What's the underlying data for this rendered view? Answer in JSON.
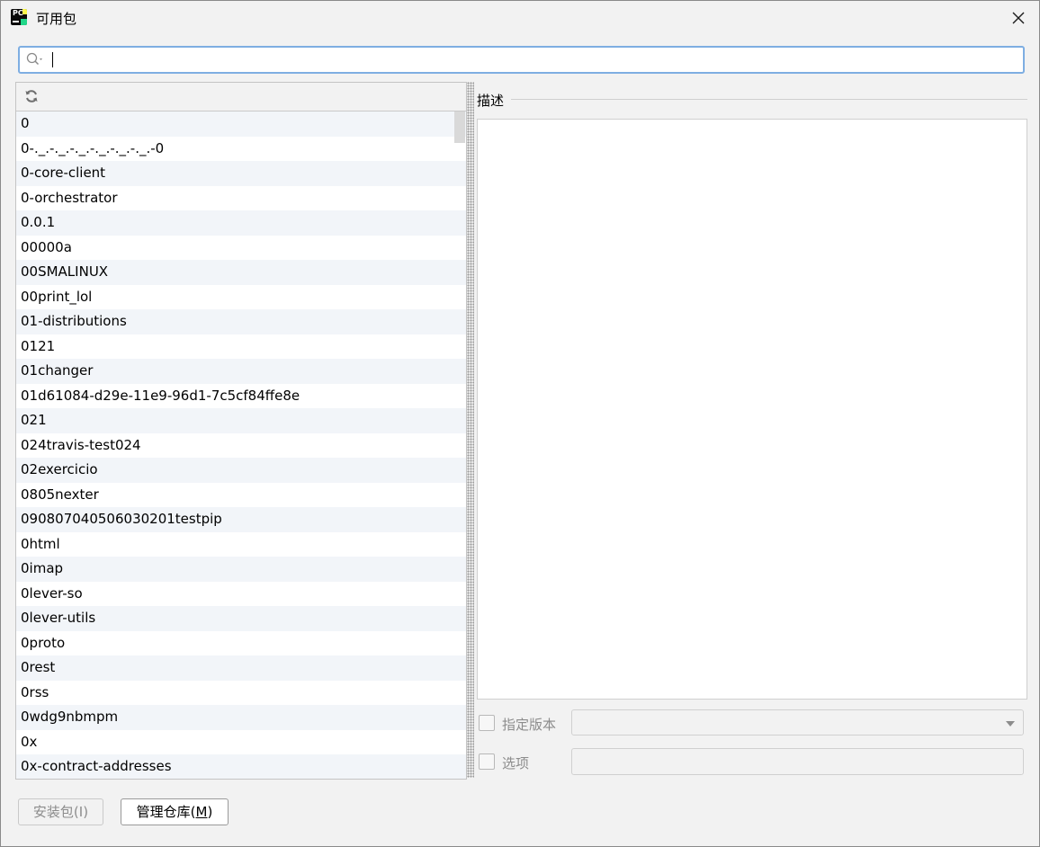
{
  "window": {
    "title": "可用包",
    "close_glyph": "✕"
  },
  "search": {
    "value": "",
    "placeholder": ""
  },
  "toolbar": {
    "refresh_icon": "refresh-icon"
  },
  "packages": [
    "0",
    "0-._.-._.-._.-._.-._.-._.-0",
    "0-core-client",
    "0-orchestrator",
    "0.0.1",
    "00000a",
    "00SMALINUX",
    "00print_lol",
    "01-distributions",
    "0121",
    "01changer",
    "01d61084-d29e-11e9-96d1-7c5cf84ffe8e",
    "021",
    "024travis-test024",
    "02exercicio",
    "0805nexter",
    "090807040506030201testpip",
    "0html",
    "0imap",
    "0lever-so",
    "0lever-utils",
    "0proto",
    "0rest",
    "0rss",
    "0wdg9nbmpm",
    "0x",
    "0x-contract-addresses"
  ],
  "description": {
    "label": "描述",
    "text": ""
  },
  "version": {
    "label": "指定版本",
    "checked": false,
    "selected": ""
  },
  "options": {
    "label": "选项",
    "checked": false,
    "value": ""
  },
  "buttons": {
    "install": "安装包(I)",
    "manage_prefix": "管理仓库(",
    "manage_mnemonic": "M",
    "manage_suffix": ")"
  },
  "colors": {
    "accent": "#7eaee2",
    "row_alt": "#f2f5f9"
  }
}
